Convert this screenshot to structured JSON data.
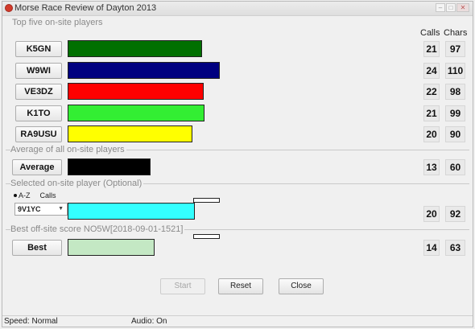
{
  "window": {
    "title": "Morse Race Review of Dayton 2013"
  },
  "sections": {
    "top_five": "Top five on-site players",
    "average": "Average of all on-site players",
    "selected": "Selected on-site player (Optional)",
    "best": "Best off-site score NO5W[2018-09-01-1521]"
  },
  "headers": {
    "calls": "Calls",
    "chars": "Chars"
  },
  "bar_scale_max_chars": 110,
  "players": [
    {
      "name": "K5GN",
      "calls": "21",
      "chars": "97",
      "color": "#007000"
    },
    {
      "name": "W9WI",
      "calls": "24",
      "chars": "110",
      "color": "#000080"
    },
    {
      "name": "VE3DZ",
      "calls": "22",
      "chars": "98",
      "color": "#ff0000"
    },
    {
      "name": "K1TO",
      "calls": "21",
      "chars": "99",
      "color": "#33ee33"
    },
    {
      "name": "RA9USU",
      "calls": "20",
      "chars": "90",
      "color": "#ffff00"
    }
  ],
  "average": {
    "label": "Average",
    "calls": "13",
    "chars": "60",
    "color": "#000000"
  },
  "selected": {
    "sort_options": [
      "A-Z",
      "Calls"
    ],
    "sort_selected": "A-Z",
    "player_value": "9V1YC",
    "calls": "20",
    "chars": "92",
    "color": "#33ffff"
  },
  "best": {
    "label": "Best",
    "calls": "14",
    "chars": "63",
    "color": "#c4e8c4"
  },
  "buttons": {
    "start": "Start",
    "reset": "Reset",
    "close": "Close"
  },
  "status": {
    "speed": "Speed: Normal",
    "audio": "Audio: On"
  },
  "icons": {
    "app": "app-icon",
    "minimize": "minimize-icon",
    "maximize": "maximize-icon",
    "close": "close-icon",
    "dropdown": "chevron-down-icon"
  }
}
